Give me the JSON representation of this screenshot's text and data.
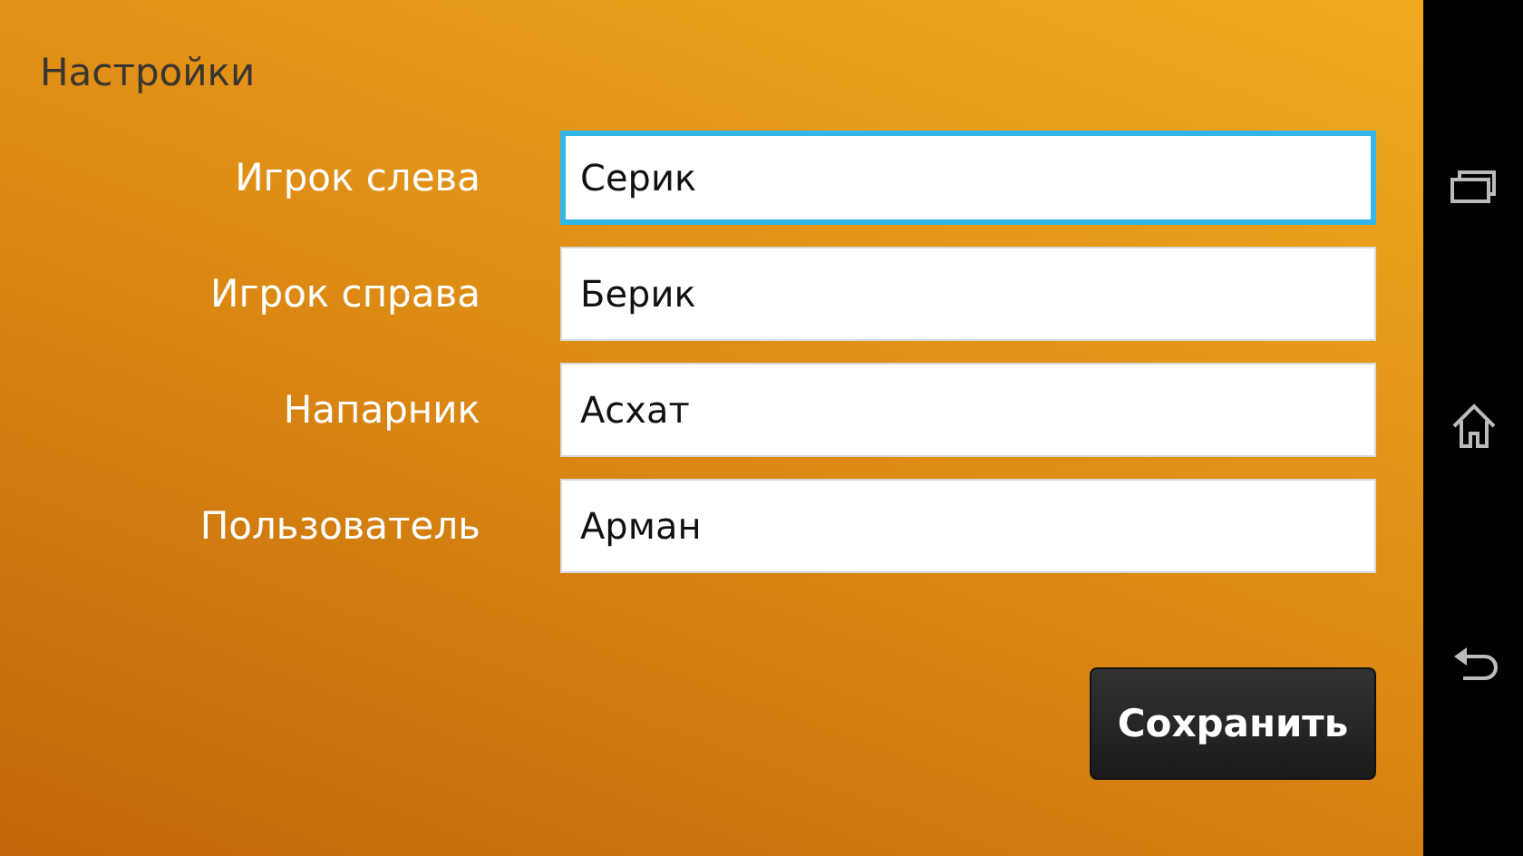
{
  "title": "Настройки",
  "fields": [
    {
      "label": "Игрок слева",
      "value": "Серик",
      "focused": true
    },
    {
      "label": "Игрок справа",
      "value": "Берик",
      "focused": false
    },
    {
      "label": "Напарник",
      "value": "Асхат",
      "focused": false
    },
    {
      "label": "Пользователь",
      "value": "Арман",
      "focused": false
    }
  ],
  "save_button": "Сохранить"
}
